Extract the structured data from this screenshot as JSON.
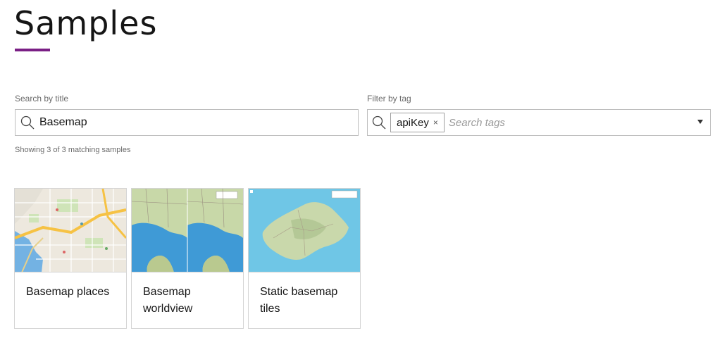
{
  "page": {
    "title": "Samples",
    "accent_color": "#7a1f85"
  },
  "search": {
    "label": "Search by title",
    "value": "Basemap",
    "icon": "search-icon"
  },
  "tag_filter": {
    "label": "Filter by tag",
    "selected_tag": "apiKey",
    "remove_glyph": "×",
    "placeholder": "Search tags",
    "icon": "search-icon"
  },
  "results": {
    "count_text": "Showing 3 of 3 matching samples"
  },
  "cards": [
    {
      "title": "Basemap places",
      "thumbnail": "city-street-map"
    },
    {
      "title": "Basemap worldview",
      "thumbnail": "gulf-region-split-map"
    },
    {
      "title": "Static basemap tiles",
      "thumbnail": "island-map"
    }
  ]
}
